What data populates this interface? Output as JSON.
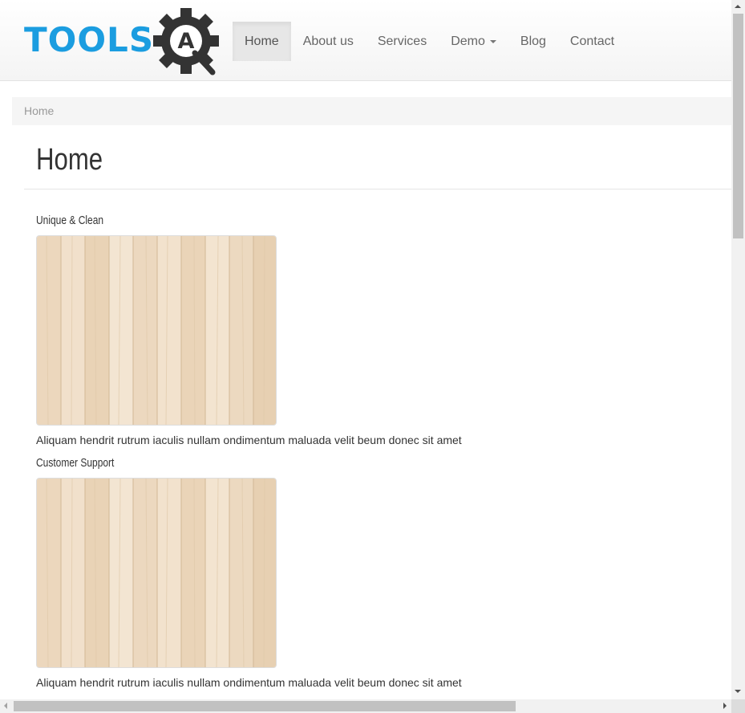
{
  "logo": {
    "text": "TOOLS",
    "gear_letter": "A",
    "color": "#1b9de0",
    "gear_color": "#333333"
  },
  "nav": {
    "items": [
      {
        "label": "Home",
        "active": true
      },
      {
        "label": "About us"
      },
      {
        "label": "Services"
      },
      {
        "label": "Demo",
        "dropdown": true
      },
      {
        "label": "Blog"
      },
      {
        "label": "Contact"
      }
    ]
  },
  "breadcrumb": {
    "current": "Home"
  },
  "page": {
    "title": "Home"
  },
  "features": [
    {
      "title": "Unique & Clean",
      "image": "wood-planks",
      "text": "Aliquam hendrit rutrum iaculis nullam ondimentum maluada velit beum donec sit amet"
    },
    {
      "title": "Customer Support",
      "image": "wood-planks",
      "text": "Aliquam hendrit rutrum iaculis nullam ondimentum maluada velit beum donec sit amet"
    }
  ]
}
